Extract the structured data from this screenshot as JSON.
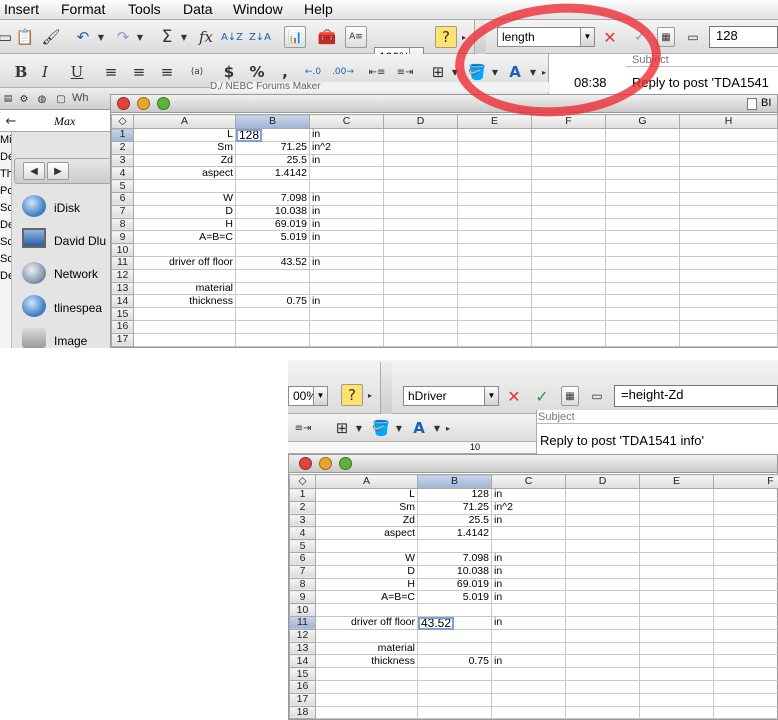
{
  "menu": [
    "Insert",
    "Format",
    "Tools",
    "Data",
    "Window",
    "Help"
  ],
  "top": {
    "zoom": "100%",
    "namebox": "length",
    "formula": "128",
    "subject_label": "Subject",
    "subject_text": "Reply to post 'TDA1541",
    "time_fragment": "08:38",
    "behind_text": "D,/ NEBC Forums Maker",
    "format_labels": {
      "bold": "B",
      "italic": "I",
      "underline": "U",
      "currency": "$",
      "percent": "%",
      "comma": ","
    }
  },
  "bottom": {
    "zoom": "00%",
    "namebox": "hDriver",
    "formula": "=height-Zd",
    "subject_label": "Subject",
    "subject_text": "Reply to post 'TDA1541 info'",
    "ruler": "10"
  },
  "finder": {
    "items": [
      "iDisk",
      "David Dlu",
      "Network",
      "tlinespea",
      "Image"
    ],
    "left_cut": [
      "Mi",
      "De",
      "Th",
      "Po",
      "Sc",
      "De",
      "Sc",
      "Sc",
      "De"
    ],
    "toolbar_text": "Wh",
    "cell_text": "Max"
  },
  "sheet": {
    "cols_top": [
      "A",
      "B",
      "C",
      "D",
      "E",
      "F",
      "G",
      "H"
    ],
    "cols_bottom": [
      "A",
      "B",
      "C",
      "D",
      "E",
      "F"
    ],
    "rows": [
      [
        "L",
        "128",
        "in"
      ],
      [
        "Sm",
        "71.25",
        "in^2"
      ],
      [
        "Zd",
        "25.5",
        "in"
      ],
      [
        "aspect",
        "1.4142",
        ""
      ],
      [
        "",
        "",
        ""
      ],
      [
        "W",
        "7.098",
        "in"
      ],
      [
        "D",
        "10.038",
        "in"
      ],
      [
        "H",
        "69.019",
        "in"
      ],
      [
        "A=B=C",
        "5.019",
        "in"
      ],
      [
        "",
        "",
        ""
      ],
      [
        "driver off floor",
        "43.52",
        "in"
      ],
      [
        "",
        "",
        ""
      ],
      [
        "material",
        "",
        ""
      ],
      [
        "thickness",
        "0.75",
        "in"
      ],
      [
        "",
        "",
        ""
      ],
      [
        "",
        "",
        ""
      ],
      [
        "",
        "",
        ""
      ],
      [
        "",
        "",
        ""
      ]
    ],
    "right_label": "BI"
  },
  "colors": {
    "annotation": "#ec2832",
    "selection": "#9fb3d3"
  }
}
